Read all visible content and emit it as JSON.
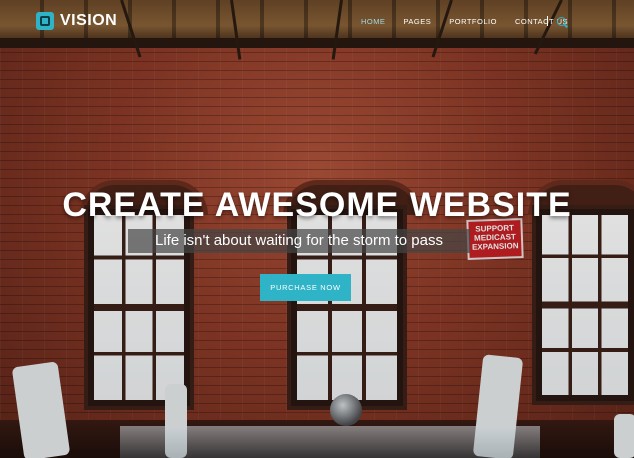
{
  "brand": {
    "name": "VISION",
    "logo_icon": "square-camera-icon",
    "accent_color": "#2fb3c6"
  },
  "nav": {
    "items": [
      {
        "label": "HOME",
        "active": true
      },
      {
        "label": "PAGES",
        "active": false
      },
      {
        "label": "PORTFOLIO",
        "active": false
      },
      {
        "label": "CONTACT US",
        "active": false
      }
    ],
    "search_icon": "search-icon"
  },
  "hero": {
    "title": "CREATE AWESOME WEBSITE",
    "subtitle": "Life isn't about waiting for the storm to pass",
    "cta_label": "PURCHASE NOW"
  },
  "background_sign": {
    "lines": [
      "SUPPORT",
      "MEDICAST",
      "EXPANSION"
    ]
  }
}
